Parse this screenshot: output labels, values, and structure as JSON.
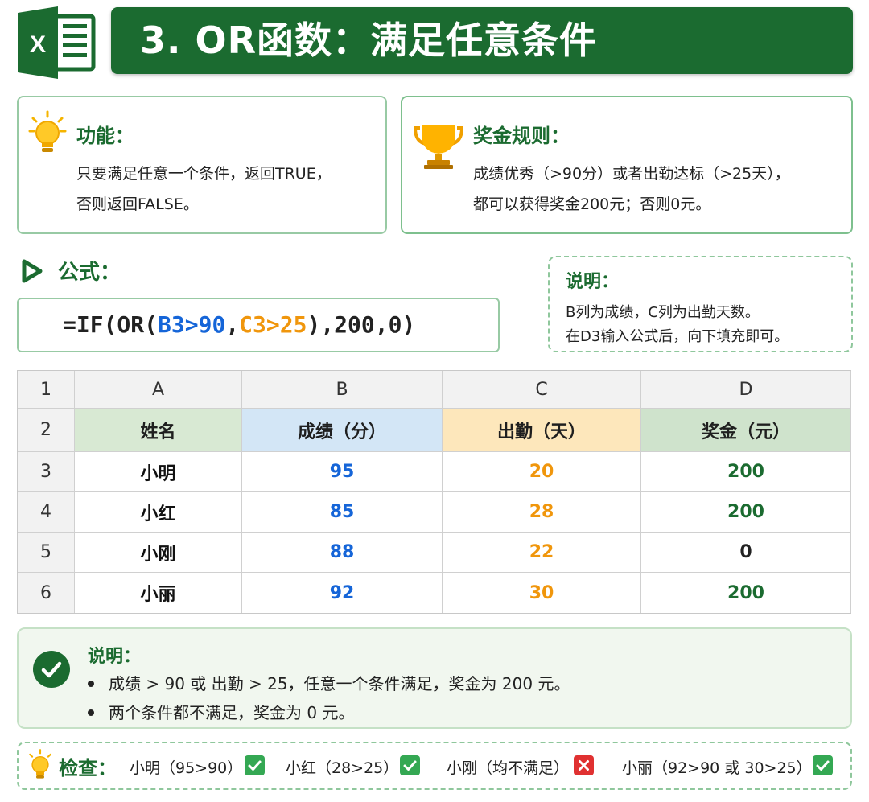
{
  "header": {
    "logo_letter": "X",
    "title": "3. OR函数：满足任意条件"
  },
  "function_card": {
    "title": "功能：",
    "lines": [
      "只要满足任意一个条件，返回TRUE，",
      "否则返回FALSE。"
    ]
  },
  "rule_card": {
    "title": "奖金规则：",
    "lines": [
      "成绩优秀（>90分）或者出勤达标（>25天），",
      "都可以获得奖金200元；否则0元。"
    ]
  },
  "formula": {
    "heading": "公式：",
    "parts": [
      "=IF(OR(",
      "B3>90",
      ",",
      "C3>25",
      "),200,0)"
    ]
  },
  "note": {
    "title": "说明：",
    "lines": [
      "B列为成绩，C列为出勤天数。",
      "在D3输入公式后，向下填充即可。"
    ]
  },
  "sheet": {
    "col_letters": [
      "A",
      "B",
      "C",
      "D"
    ],
    "row_numbers": [
      "1",
      "2",
      "3",
      "4",
      "5",
      "6"
    ],
    "headers": [
      "姓名",
      "成绩（分）",
      "出勤（天）",
      "奖金（元）"
    ],
    "rows": [
      [
        "小明",
        "95",
        "20",
        "200"
      ],
      [
        "小红",
        "85",
        "28",
        "200"
      ],
      [
        "小刚",
        "88",
        "22",
        "0"
      ],
      [
        "小丽",
        "92",
        "30",
        "200"
      ]
    ],
    "colors": {
      "header_a": "#d8e9d3",
      "header_b": "#d3e6f6",
      "header_c": "#fde7bb",
      "header_d": "#cfe3cc",
      "score": "#1565d8",
      "attendance": "#f0960c",
      "bonus": "#1b6b30"
    }
  },
  "explanation": {
    "title": "说明：",
    "bullets": [
      "成绩 > 90 或 出勤 > 25，任意一个条件满足，奖金为 200 元。",
      "两个条件都不满足，奖金为 0 元。"
    ]
  },
  "checks": {
    "title": "检查：",
    "items": [
      {
        "label": "小明（95>90）",
        "result": "pass"
      },
      {
        "label": "小红（28>25）",
        "result": "pass"
      },
      {
        "label": "小刚（均不满足）",
        "result": "fail"
      },
      {
        "label": "小丽（92>90 或 30>25）",
        "result": "pass"
      }
    ]
  },
  "theme": {
    "brand_green": "#1b6b30",
    "check_green": "#34a853",
    "cross_red": "#e03131"
  }
}
